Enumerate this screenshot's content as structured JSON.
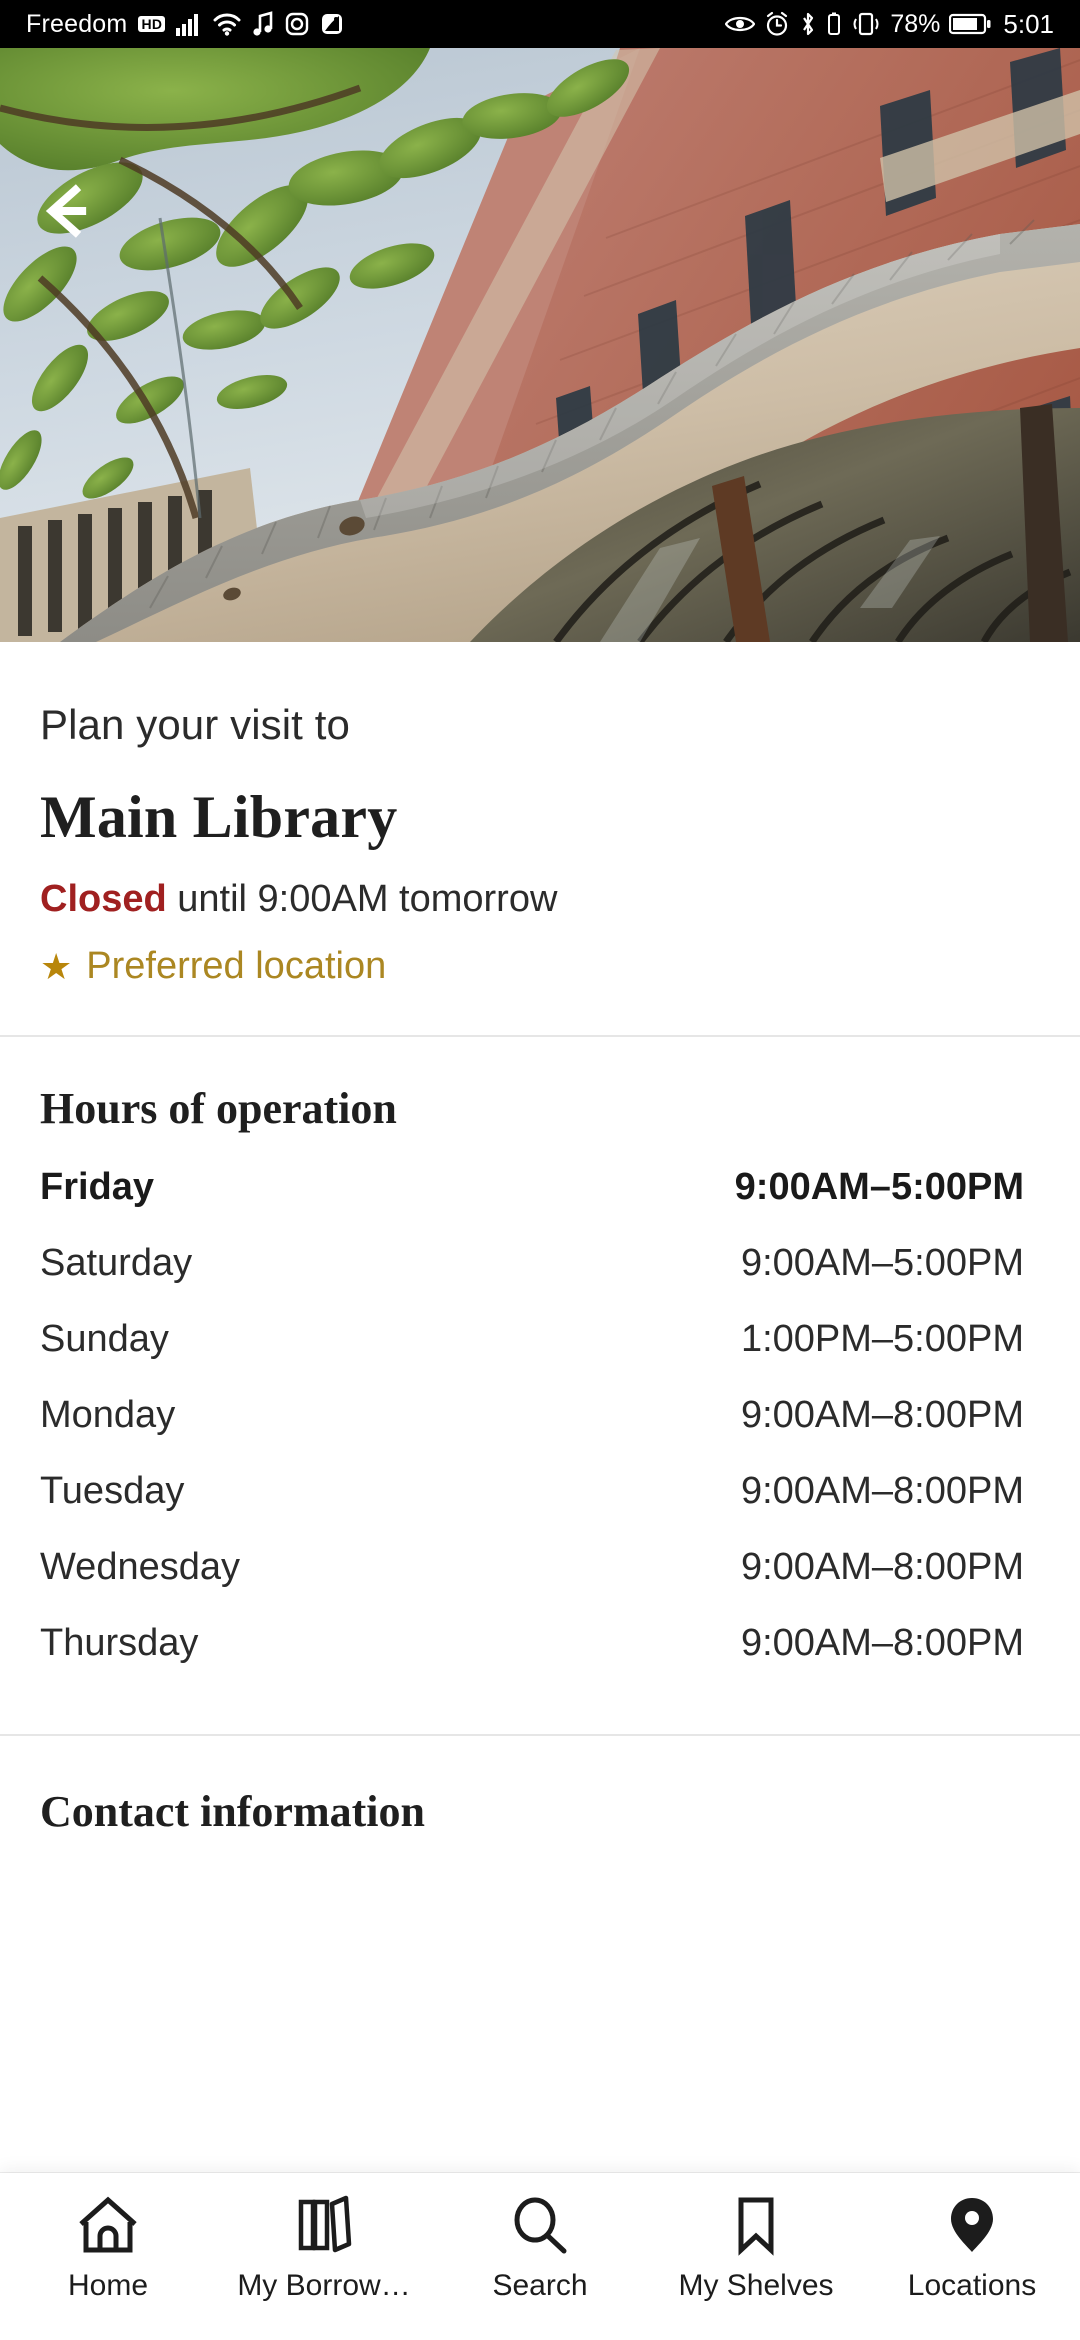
{
  "status_bar": {
    "carrier": "Freedom",
    "network_badge": "HD",
    "battery_percent": "78%",
    "time": "5:01",
    "left_icons": [
      "signal-bars-icon",
      "wifi-icon",
      "music-note-icon",
      "instagram-icon",
      "screenshot-icon"
    ],
    "right_icons": [
      "eye-icon",
      "alarm-clock-icon",
      "bluetooth-icon",
      "bluetooth-battery-icon",
      "vibrate-icon",
      "battery-icon"
    ]
  },
  "hero": {
    "back_icon": "back-arrow-icon",
    "alt": "Main Library exterior with brick facade and curved canopy"
  },
  "location": {
    "eyebrow": "Plan your visit to",
    "name": "Main Library",
    "status_word": "Closed",
    "status_rest": " until 9:00AM tomorrow",
    "preferred_label": "Preferred location",
    "preferred_icon": "star-icon"
  },
  "hours": {
    "title": "Hours of operation",
    "rows": [
      {
        "day": "Friday",
        "time": "9:00AM–5:00PM",
        "today": true
      },
      {
        "day": "Saturday",
        "time": "9:00AM–5:00PM",
        "today": false
      },
      {
        "day": "Sunday",
        "time": "1:00PM–5:00PM",
        "today": false
      },
      {
        "day": "Monday",
        "time": "9:00AM–8:00PM",
        "today": false
      },
      {
        "day": "Tuesday",
        "time": "9:00AM–8:00PM",
        "today": false
      },
      {
        "day": "Wednesday",
        "time": "9:00AM–8:00PM",
        "today": false
      },
      {
        "day": "Thursday",
        "time": "9:00AM–8:00PM",
        "today": false
      }
    ]
  },
  "contact": {
    "title": "Contact information"
  },
  "bottom_nav": {
    "items": [
      {
        "label": "Home",
        "icon": "home-icon",
        "active": false
      },
      {
        "label": "My Borrow…",
        "icon": "books-icon",
        "active": false
      },
      {
        "label": "Search",
        "icon": "search-icon",
        "active": false
      },
      {
        "label": "My Shelves",
        "icon": "bookmark-icon",
        "active": false
      },
      {
        "label": "Locations",
        "icon": "map-pin-icon",
        "active": true
      }
    ]
  },
  "colors": {
    "closed_red": "#a02020",
    "preferred_gold": "#ab8722",
    "star_gold": "#b8860b",
    "text_primary": "#2b2b2b",
    "divider": "#e6e6e6"
  }
}
